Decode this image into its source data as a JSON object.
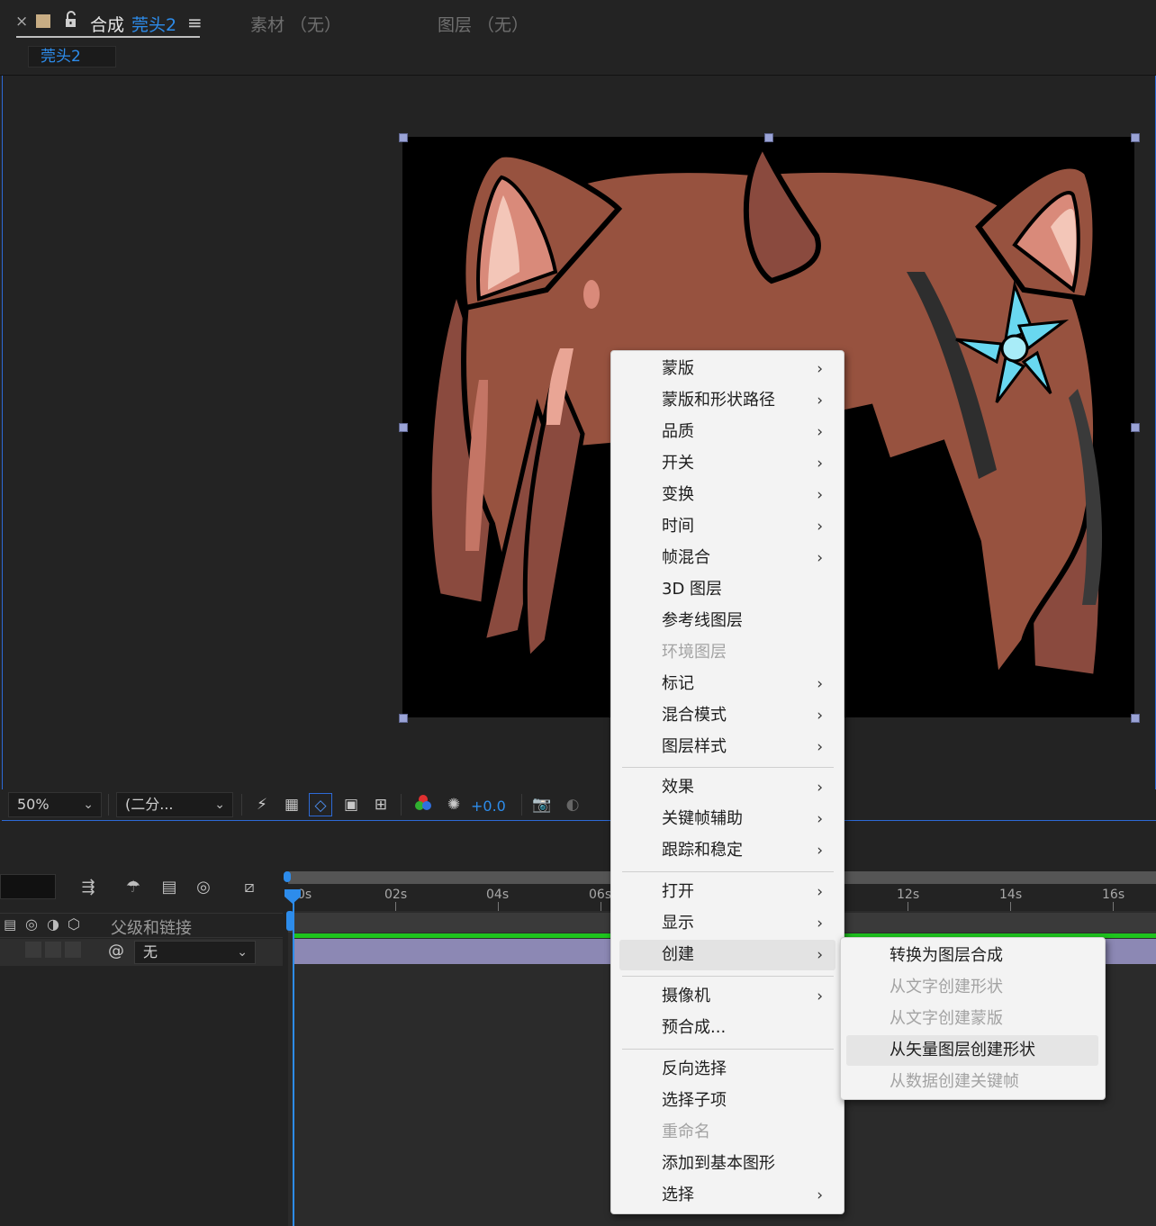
{
  "tabs": {
    "close": "×",
    "comp_label": "合成",
    "comp_name": "莞头2",
    "menu_glyph": "≡",
    "footage": "素材 （无）",
    "layer": "图层 （无）",
    "subtab": "莞头2"
  },
  "colors": {
    "accent": "#2d8ceb",
    "comp_swatch": "#c8ad84",
    "layer_bar": "#8c88b4",
    "green_bar": "#1ec41e"
  },
  "viewer_toolbar": {
    "zoom": "50%",
    "resolution": "(二分...",
    "exposure": "+0.0"
  },
  "timeline": {
    "parent_header": "父级和链接",
    "parent_value": "无",
    "ruler": [
      "0s",
      "02s",
      "04s",
      "06s",
      "12s",
      "14s",
      "16s"
    ]
  },
  "context_menu": {
    "items": [
      {
        "label": "蒙版",
        "submenu": true
      },
      {
        "label": "蒙版和形状路径",
        "submenu": true
      },
      {
        "label": "品质",
        "submenu": true
      },
      {
        "label": "开关",
        "submenu": true
      },
      {
        "label": "变换",
        "submenu": true
      },
      {
        "label": "时间",
        "submenu": true
      },
      {
        "label": "帧混合",
        "submenu": true
      },
      {
        "label": "3D 图层"
      },
      {
        "label": "参考线图层"
      },
      {
        "label": "环境图层",
        "disabled": true
      },
      {
        "label": "标记",
        "submenu": true
      },
      {
        "label": "混合模式",
        "submenu": true
      },
      {
        "label": "图层样式",
        "submenu": true
      },
      {
        "label": "效果",
        "submenu": true
      },
      {
        "label": "关键帧辅助",
        "submenu": true
      },
      {
        "label": "跟踪和稳定",
        "submenu": true
      },
      {
        "label": "打开",
        "submenu": true
      },
      {
        "label": "显示",
        "submenu": true
      },
      {
        "label": "创建",
        "submenu": true,
        "hover": true
      },
      {
        "label": "摄像机",
        "submenu": true
      },
      {
        "label": "预合成..."
      },
      {
        "label": "反向选择"
      },
      {
        "label": "选择子项"
      },
      {
        "label": "重命名",
        "disabled": true
      },
      {
        "label": "添加到基本图形"
      },
      {
        "label": "选择",
        "submenu": true
      }
    ],
    "arrow_glyph": "›"
  },
  "create_submenu": {
    "items": [
      {
        "label": "转换为图层合成"
      },
      {
        "label": "从文字创建形状",
        "disabled": true
      },
      {
        "label": "从文字创建蒙版",
        "disabled": true
      },
      {
        "label": "从矢量图层创建形状",
        "hover": true
      },
      {
        "label": "从数据创建关键帧",
        "disabled": true
      }
    ]
  }
}
